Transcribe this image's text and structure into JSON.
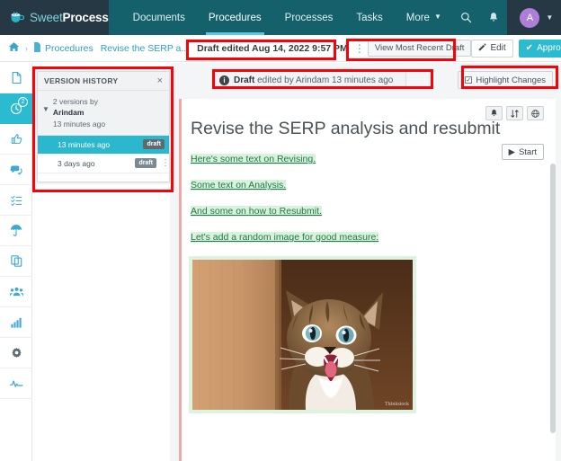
{
  "brand": {
    "sweet": "Sweet",
    "process": "Process"
  },
  "topnav": {
    "items": [
      {
        "label": "Documents",
        "active": false
      },
      {
        "label": "Procedures",
        "active": true
      },
      {
        "label": "Processes",
        "active": false
      },
      {
        "label": "Tasks",
        "active": false
      },
      {
        "label": "More",
        "active": false,
        "caret": "▾"
      }
    ],
    "search_icon": "⌕",
    "bell_icon": "ὑ4",
    "avatar_letter": "A",
    "user_caret": "▾"
  },
  "breadcrumb": {
    "home_icon": "⌂",
    "separator": "›",
    "doc_icon": "὜b",
    "procedures": "Procedures",
    "current": "Revise the SERP a...",
    "draft_stamp": "Draft edited Aug 14, 2022 9:57 PM",
    "kebab": "⋮",
    "view_recent_draft": "View Most Recent Draft",
    "edit_label": "Edit",
    "edit_icon": "✎",
    "approve_label": "Approve",
    "approve_check": "✔",
    "approve_caret": "▾"
  },
  "rail": {
    "items": [
      {
        "name": "document",
        "glyph": "὜b",
        "active": false,
        "dark": false
      },
      {
        "name": "history",
        "glyph": "ὕ3",
        "active": true,
        "dark": false,
        "badge": "2"
      },
      {
        "name": "thumbs-up",
        "glyph": "ὄd",
        "active": false,
        "dark": false
      },
      {
        "name": "comments",
        "glyph": "὞a",
        "active": false,
        "dark": false
      },
      {
        "name": "checklist",
        "glyph": "≣",
        "active": false,
        "dark": false
      },
      {
        "name": "umbrella",
        "glyph": "☂",
        "active": false,
        "dark": false
      },
      {
        "name": "copy",
        "glyph": "⧉",
        "active": false,
        "dark": false
      },
      {
        "name": "team",
        "glyph": "὆5",
        "active": false,
        "dark": false
      },
      {
        "name": "analytics",
        "glyph": "Ὄa",
        "active": false,
        "dark": false
      },
      {
        "name": "gear",
        "glyph": "⚙",
        "active": false,
        "dark": true
      },
      {
        "name": "activity",
        "glyph": "∿",
        "active": false,
        "dark": false
      }
    ]
  },
  "version_history": {
    "title": "VERSION HISTORY",
    "close_icon": "×",
    "chevron": "⌄",
    "group_count": "2 versions by",
    "group_author": "Arindam",
    "group_time": "13 minutes ago",
    "rows": [
      {
        "label": "13 minutes ago",
        "tag": "draft",
        "selected": true,
        "kebab": ""
      },
      {
        "label": "3 days ago",
        "tag": "draft",
        "selected": false,
        "kebab": "⋮"
      }
    ]
  },
  "notice": {
    "icon": "i",
    "prefix": "Draft",
    "rest": " edited by Arindam 13 minutes ago"
  },
  "highlight_changes": {
    "label": "Highlight Changes",
    "check": "✓"
  },
  "document": {
    "title": "Revise the SERP analysis and resubmit",
    "icon_buttons": [
      {
        "name": "bell",
        "glyph": "ὑ4"
      },
      {
        "name": "sort",
        "glyph": "⇅"
      },
      {
        "name": "globe",
        "glyph": "ἱ0"
      }
    ],
    "start_label": "Start",
    "start_icon": "▶",
    "paragraphs": [
      "Here's some text on Revising. ",
      "Some text on Analysis. ",
      "And some on how to Resubmit. ",
      "Let's add a random image for good measure: "
    ],
    "image_watermark": "Thinkstock",
    "image_alt": "kitten-photo"
  },
  "colors": {
    "nav_bg": "#14616b",
    "brand_bg": "#263843",
    "accent_teal": "#2bbbd0",
    "annotation_red": "#fb0007",
    "highlight_green": "#d9f2dd",
    "green_text": "#1e7a44"
  }
}
